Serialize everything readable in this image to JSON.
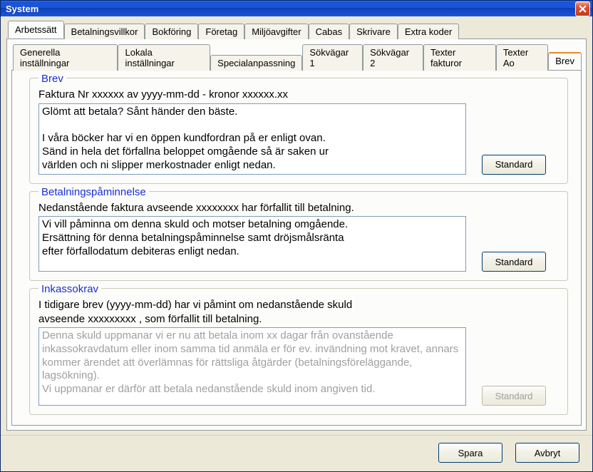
{
  "window": {
    "title": "System"
  },
  "tabs_outer": [
    {
      "label": "Arbetssätt",
      "active": true
    },
    {
      "label": "Betalningsvillkor"
    },
    {
      "label": "Bokföring"
    },
    {
      "label": "Företag"
    },
    {
      "label": "Miljöavgifter"
    },
    {
      "label": "Cabas"
    },
    {
      "label": "Skrivare"
    },
    {
      "label": "Extra koder"
    }
  ],
  "tabs_inner": [
    {
      "label": "Generella inställningar"
    },
    {
      "label": "Lokala inställningar"
    },
    {
      "label": "Specialanpassning"
    },
    {
      "label": "Sökvägar 1"
    },
    {
      "label": "Sökvägar 2"
    },
    {
      "label": "Texter fakturor"
    },
    {
      "label": "Texter Ao"
    },
    {
      "label": "Brev",
      "active": true
    }
  ],
  "sections": {
    "brev": {
      "title": "Brev",
      "subtitle": "Faktura Nr xxxxxx av yyyy-mm-dd - kronor xxxxxx.xx",
      "text": "Glömt att betala? Sånt händer den bäste.\n\nI våra böcker har vi en öppen kundfordran på er enligt ovan.\nSänd in hela det förfallna beloppet omgående så är saken ur\nvärlden och ni slipper merkostnader enligt nedan.",
      "button": "Standard"
    },
    "paminnelse": {
      "title": "Betalningspåminnelse",
      "subtitle": "Nedanstående faktura avseende xxxxxxxx har förfallit till betalning.",
      "text": "Vi vill påminna om denna skuld och motser betalning omgående.\nErsättning för denna betalningspåminnelse samt dröjsmålsränta\nefter förfallodatum debiteras enligt nedan.",
      "button": "Standard"
    },
    "inkasso": {
      "title": "Inkassokrav",
      "subtitle": "I tidigare brev (yyyy-mm-dd) har vi påmint om nedanstående skuld\navseende xxxxxxxxx , som förfallit till betalning.",
      "text": "Denna skuld uppmanar vi er nu att betala inom xx dagar från ovanstående inkassokravdatum eller inom samma tid anmäla er för ev. invändning mot kravet, annars kommer ärendet att överlämnas för rättsliga åtgärder (betalningsföreläggande, lagsökning).\nVi uppmanar er därför att betala nedanstående skuld inom angiven tid.",
      "button": "Standard"
    }
  },
  "footer": {
    "save": "Spara",
    "cancel": "Avbryt"
  }
}
